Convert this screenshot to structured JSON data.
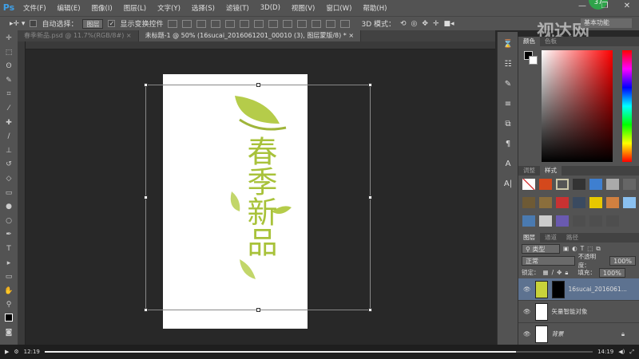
{
  "app": {
    "logo": "Ps"
  },
  "menu": [
    "文件(F)",
    "编辑(E)",
    "图像(I)",
    "图层(L)",
    "文字(Y)",
    "选择(S)",
    "滤镜(T)",
    "3D(D)",
    "视图(V)",
    "窗口(W)",
    "帮助(H)"
  ],
  "badge": "37",
  "window_buttons": [
    "—",
    "❐",
    "✕"
  ],
  "options": {
    "auto_select_label": "自动选择：",
    "auto_select_value": "图层",
    "show_transform_label": "显示变换控件",
    "mode_3d_label": "3D 模式：",
    "workspace": "基本功能"
  },
  "watermark": "视达网",
  "tabs": [
    {
      "label": "春季新品.psd @ 11.7%(RGB/8#)",
      "active": false
    },
    {
      "label": "未标题-1 @ 50% (16sucai_2016061201_00010 (3), 图层蒙版/8) *",
      "active": true
    }
  ],
  "artwork_text": "春季新品",
  "panels": {
    "color": {
      "tabs": [
        "颜色",
        "色板"
      ]
    },
    "styles": {
      "tabs": [
        "调整",
        "样式"
      ]
    },
    "layers": {
      "tabs": [
        "图层",
        "通道",
        "路径"
      ],
      "filter": "类型",
      "blend_mode": "正常",
      "opacity_label": "不透明度：",
      "opacity": "100%",
      "lock_label": "锁定：",
      "fill_label": "填充：",
      "fill": "100%",
      "layers": [
        {
          "name": "16sucai_2016061...",
          "selected": true
        },
        {
          "name": "矢量智能对象",
          "selected": false
        },
        {
          "name": "背景",
          "selected": false
        }
      ]
    }
  },
  "video": {
    "current": "12:19",
    "total": "14:19",
    "progress": 0.86
  },
  "colors": {
    "accent": "#3fa0e8",
    "selected_layer": "#5d7290",
    "art_green": "#a8c23a"
  }
}
